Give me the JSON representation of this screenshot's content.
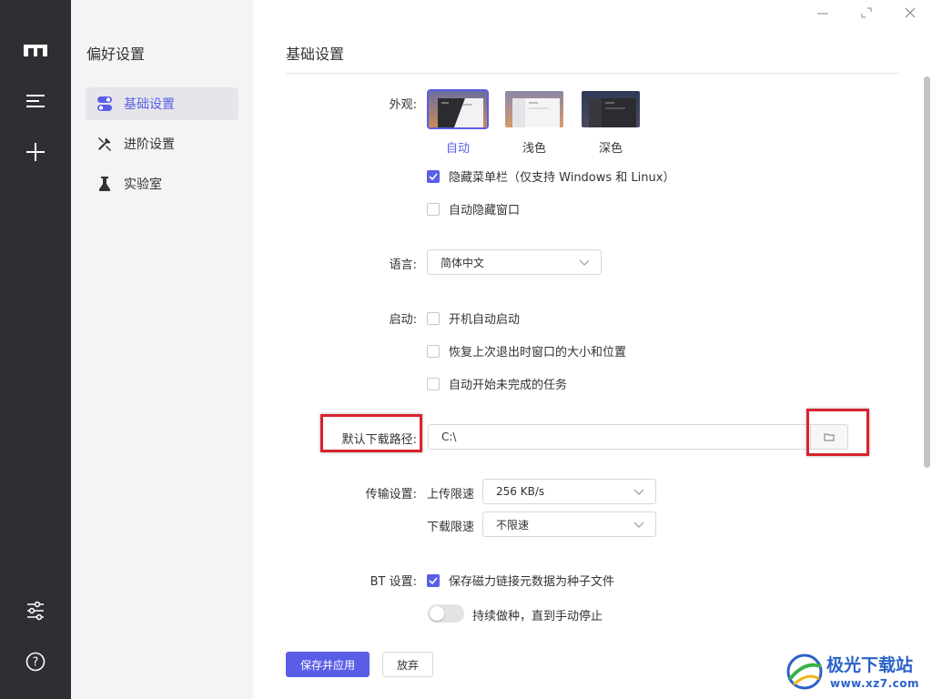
{
  "rail": {
    "icons": [
      "logo-icon",
      "list-icon",
      "plus-icon",
      "sliders-icon",
      "help-icon"
    ]
  },
  "sidebar": {
    "title": "偏好设置",
    "items": [
      {
        "label": "基础设置",
        "icon": "toggle-icon",
        "active": true
      },
      {
        "label": "进阶设置",
        "icon": "tools-icon",
        "active": false
      },
      {
        "label": "实验室",
        "icon": "flask-icon",
        "active": false
      }
    ]
  },
  "main": {
    "title": "基础设置",
    "appearance": {
      "label": "外观:",
      "themes": [
        {
          "label": "自动",
          "selected": true
        },
        {
          "label": "浅色",
          "selected": false
        },
        {
          "label": "深色",
          "selected": false
        }
      ],
      "options": [
        {
          "label": "隐藏菜单栏（仅支持 Windows 和 Linux）",
          "checked": true
        },
        {
          "label": "自动隐藏窗口",
          "checked": false
        }
      ]
    },
    "language": {
      "label": "语言:",
      "value": "简体中文"
    },
    "startup": {
      "label": "启动:",
      "options": [
        {
          "label": "开机自动启动",
          "checked": false
        },
        {
          "label": "恢复上次退出时窗口的大小和位置",
          "checked": false
        },
        {
          "label": "自动开始未完成的任务",
          "checked": false
        }
      ]
    },
    "download_path": {
      "label": "默认下载路径:",
      "value": "C:\\"
    },
    "transfer": {
      "label": "传输设置:",
      "upload_label": "上传限速",
      "upload_value": "256 KB/s",
      "download_label": "下载限速",
      "download_value": "不限速"
    },
    "bt": {
      "label": "BT 设置:",
      "save_magnet_label": "保存磁力链接元数据为种子文件",
      "save_magnet_checked": true,
      "seeding_label": "持续做种，直到手动停止",
      "seeding_on": false
    },
    "buttons": {
      "save": "保存并应用",
      "discard": "放弃"
    }
  },
  "watermark": {
    "name": "极光下载站",
    "url": "www.xz7.com"
  },
  "colors": {
    "accent": "#5a5ee6",
    "rail_bg": "#2f2f33",
    "sidebar_bg": "#f4f4f6",
    "highlight": "#d9232d"
  }
}
